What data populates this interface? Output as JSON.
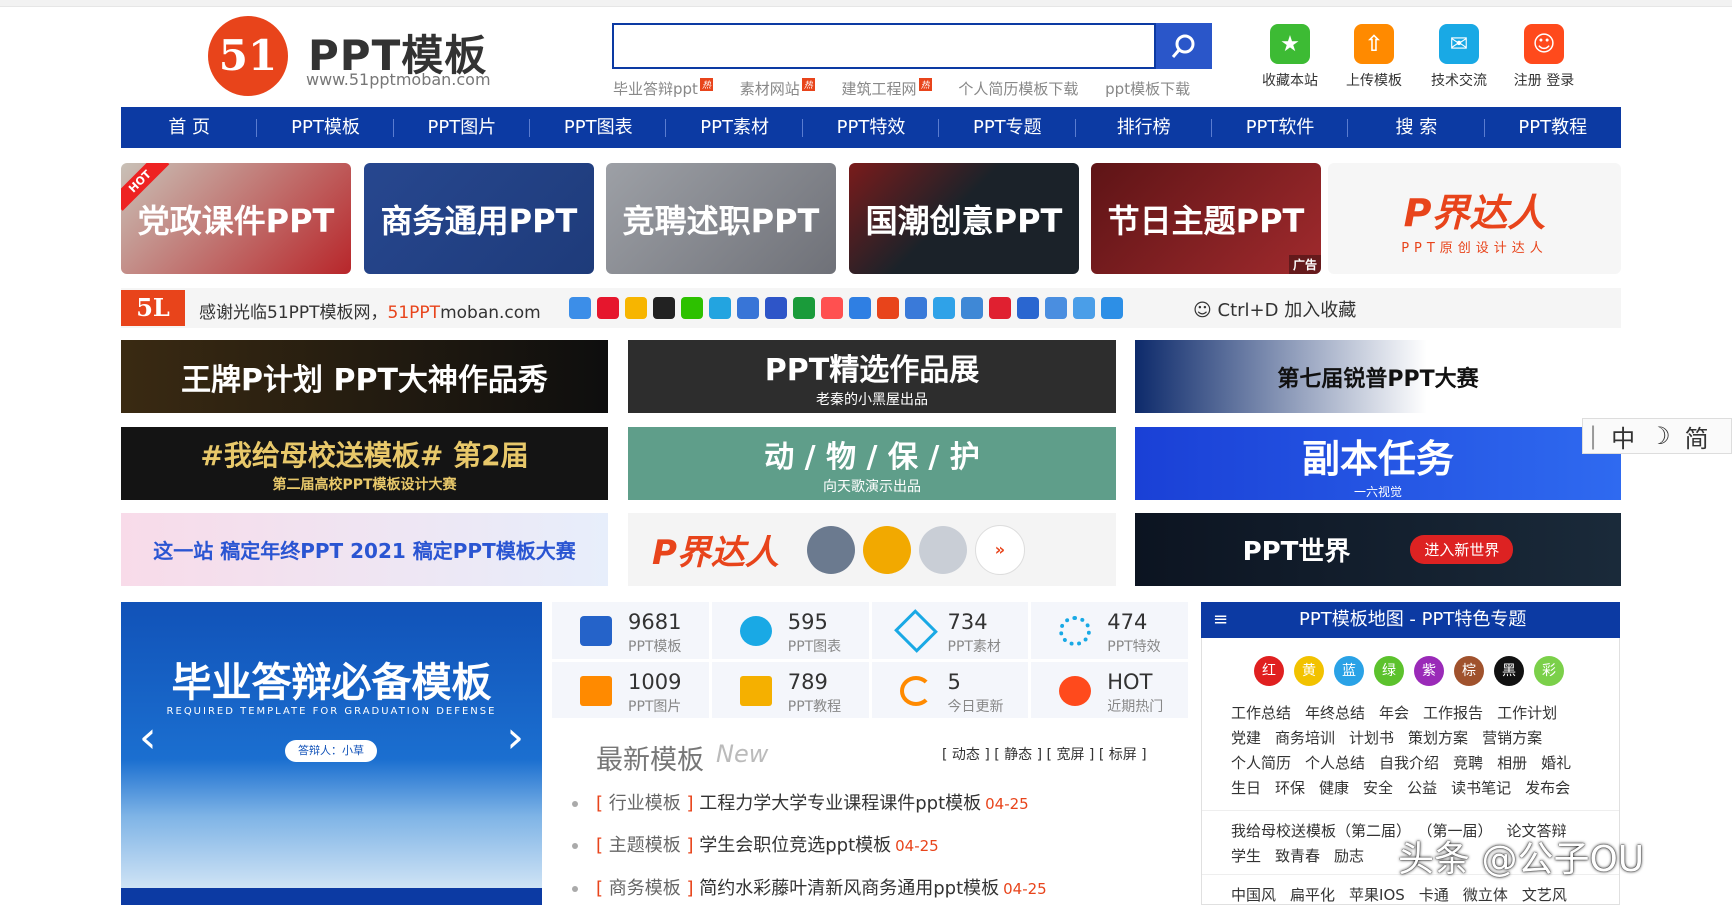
{
  "site": {
    "logo_mark": "51",
    "logo_title": "PPT模板",
    "logo_url": "www.51pptmoban.com"
  },
  "search": {
    "placeholder": "",
    "hotwords": [
      "毕业答辩ppt",
      "素材网站",
      "建筑工程网",
      "个人简历模板下载",
      "ppt模板下载"
    ],
    "hot_badge": "热"
  },
  "quick_links": [
    {
      "label": "收藏本站",
      "icon": "star-icon",
      "color": "#3dbb34"
    },
    {
      "label": "上传模板",
      "icon": "upload-icon",
      "color": "#ff8a00"
    },
    {
      "label": "技术交流",
      "icon": "chat-icon",
      "color": "#19a9e5"
    },
    {
      "label": "注册 登录",
      "icon": "user-icon",
      "color": "#ff4a1c"
    }
  ],
  "nav": [
    "首 页",
    "PPT模板",
    "PPT图片",
    "PPT图表",
    "PPT素材",
    "PPT特效",
    "PPT专题",
    "排行榜",
    "PPT软件",
    "搜 索",
    "PPT教程"
  ],
  "category_tiles": [
    {
      "label": "党政课件PPT",
      "badge": "HOT",
      "color": "#b8262a"
    },
    {
      "label": "商务通用PPT",
      "color": "#1e3b7a"
    },
    {
      "label": "竞聘述职PPT",
      "color": "#7d7f86"
    },
    {
      "label": "国潮创意PPT",
      "color": "#1b2229"
    },
    {
      "label": "节日主题PPT",
      "ad": "广告",
      "color": "#7d1d1f"
    },
    {
      "label": "P界达人",
      "sub": "PPT原创设计达人",
      "color": "#f6f6f6"
    }
  ],
  "welcome": {
    "logo": "5L",
    "text": "感谢光临51PPT模板网，",
    "site_orange": "51PPT",
    "site_rest": "moban.com",
    "bookmark": "Ctrl+D 加入收藏"
  },
  "banners": [
    {
      "label": "王牌P计划 PPT大神作品秀",
      "color": "#2a2018"
    },
    {
      "label": "PPT精选作品展",
      "sub": "老秦的小黑屋出品",
      "color": "#2d2d2d"
    },
    {
      "label": "第七届锐普PPT大赛",
      "color": "#0d2a6b"
    },
    {
      "label": "#我给母校送模板# 第2届",
      "sub": "第二届高校PPT模板设计大赛",
      "color": "#141414"
    },
    {
      "label": "动 / 物 / 保 / 护",
      "sub": "向天歌演示出品",
      "color": "#5f9e8a"
    },
    {
      "label": "副本任务",
      "sub": "一六视觉",
      "color": "#1f4fe0"
    },
    {
      "label": "这一站 稿定年终PPT 2021 稿定PPT模板大赛",
      "color": "#f3e8f6"
    },
    {
      "label": "P界达人",
      "color": "#f4f4f4"
    },
    {
      "label": "PPT世界",
      "sub": "进入新世界",
      "color": "#0c1421"
    }
  ],
  "ime": [
    "中",
    "简"
  ],
  "slider": {
    "title": "毕业答辩必备模板",
    "subtitle": "REQUIRED TEMPLATE FOR GRADUATION DEFENSE",
    "pill": "答辩人：小草"
  },
  "stats": [
    {
      "value": "9681",
      "label": "PPT模板",
      "color": "#2563c9"
    },
    {
      "value": "595",
      "label": "PPT图表",
      "color": "#19a9e5"
    },
    {
      "value": "734",
      "label": "PPT素材",
      "color": "#19a9e5"
    },
    {
      "value": "474",
      "label": "PPT特效",
      "color": "#19a9e5"
    },
    {
      "value": "1009",
      "label": "PPT图片",
      "color": "#ff8a00"
    },
    {
      "value": "789",
      "label": "PPT教程",
      "color": "#f5b000"
    },
    {
      "value": "5",
      "label": "今日更新",
      "color": "#ff8a00"
    },
    {
      "value": "HOT",
      "label": "近期热门",
      "color": "#ff4a1c"
    }
  ],
  "latest": {
    "title": "最新模板",
    "title_en": "New",
    "filters": "[ 动态 ] [ 静态 ] [ 宽屏 ] [ 标屏 ]",
    "items": [
      {
        "category": "行业模板",
        "title": "工程力学大学专业课程课件ppt模板",
        "date": "04-25"
      },
      {
        "category": "主题模板",
        "title": "学生会职位竞选ppt模板",
        "date": "04-25"
      },
      {
        "category": "商务模板",
        "title": "简约水彩藤叶清新风商务通用ppt模板",
        "date": "04-25"
      }
    ]
  },
  "map": {
    "title": "PPT模板地图 - PPT特色专题",
    "colors": [
      {
        "label": "红",
        "color": "#e02020"
      },
      {
        "label": "黄",
        "color": "#f2c200"
      },
      {
        "label": "蓝",
        "color": "#2aa2e6"
      },
      {
        "label": "绿",
        "color": "#5cc22d"
      },
      {
        "label": "紫",
        "color": "#9a2ab8"
      },
      {
        "label": "棕",
        "color": "#a0522d"
      },
      {
        "label": "黑",
        "color": "#111111"
      },
      {
        "label": "彩",
        "color": "#7bd04a"
      }
    ],
    "rows": [
      [
        "工作总结",
        "年终总结",
        "年会",
        "工作报告",
        "工作计划"
      ],
      [
        "党建",
        "商务培训",
        "计划书",
        "策划方案",
        "营销方案"
      ],
      [
        "个人简历",
        "个人总结",
        "自我介绍",
        "竞聘",
        "相册",
        "婚礼"
      ],
      [
        "生日",
        "环保",
        "健康",
        "安全",
        "公益",
        "读书笔记",
        "发布会"
      ],
      [
        "我给母校送模板（第二届）",
        "（第一届）",
        "论文答辩"
      ],
      [
        "学生",
        "致青春",
        "励志"
      ],
      [
        "中国风",
        "扁平化",
        "苹果IOS",
        "卡通",
        "微立体",
        "文艺风"
      ]
    ]
  },
  "watermark": "头条 @公子OU"
}
